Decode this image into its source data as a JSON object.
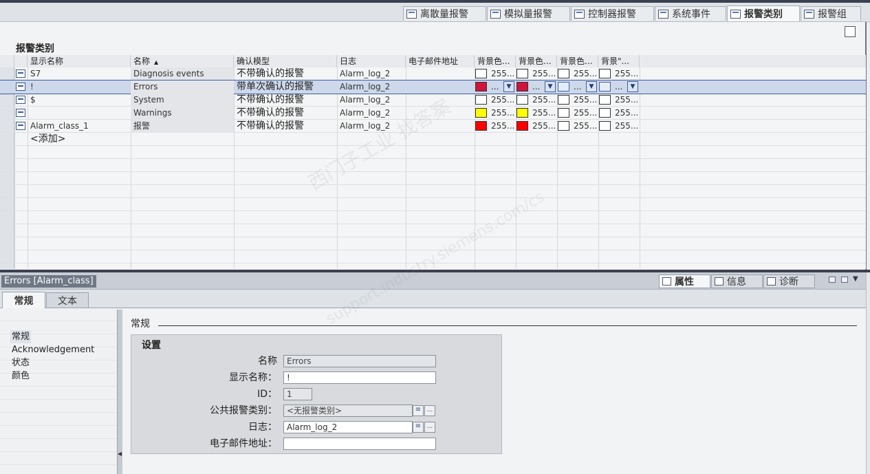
{
  "top_tabs": [
    {
      "label": "离散量报警",
      "icon": "discrete-alarm-icon",
      "active": false
    },
    {
      "label": "模拟量报警",
      "icon": "analog-alarm-icon",
      "active": false
    },
    {
      "label": "控制器报警",
      "icon": "controller-alarm-icon",
      "active": false
    },
    {
      "label": "系统事件",
      "icon": "system-event-icon",
      "active": false
    },
    {
      "label": "报警类别",
      "icon": "alarm-class-icon",
      "active": true
    },
    {
      "label": "报警组",
      "icon": "alarm-group-icon",
      "active": false
    }
  ],
  "editor": {
    "title": "报警类别",
    "columns": [
      "显示名称",
      "名称",
      "确认模型",
      "日志",
      "电子邮件地址",
      "背景色...",
      "背景色...",
      "背景色...",
      "背景\"..."
    ],
    "sort_column": "名称",
    "rows": [
      {
        "display": "S7",
        "name": "Diagnosis events",
        "ack": "不带确认的报警",
        "log": "Alarm_log_2",
        "email": "",
        "colors": [
          {
            "hex": "#ffffff",
            "val": "255..."
          },
          {
            "hex": "#ffffff",
            "val": "255..."
          },
          {
            "hex": "#ffffff",
            "val": "255..."
          },
          {
            "hex": "#ffffff",
            "val": "255..."
          }
        ],
        "selected": false
      },
      {
        "display": "!",
        "name": "Errors",
        "ack": "带单次确认的报警",
        "log": "Alarm_log_2",
        "email": "",
        "colors": [
          {
            "hex": "#d0143c",
            "val": "..."
          },
          {
            "hex": "#d0143c",
            "val": "..."
          },
          {
            "hex": "#e6ecf6",
            "val": "..."
          },
          {
            "hex": "#e6ecf6",
            "val": "..."
          }
        ],
        "selected": true
      },
      {
        "display": "$",
        "name": "System",
        "ack": "不带确认的报警",
        "log": "Alarm_log_2",
        "email": "",
        "colors": [
          {
            "hex": "#ffffff",
            "val": "255..."
          },
          {
            "hex": "#ffffff",
            "val": "255..."
          },
          {
            "hex": "#ffffff",
            "val": "255..."
          },
          {
            "hex": "#ffffff",
            "val": "255..."
          }
        ],
        "selected": false
      },
      {
        "display": "",
        "name": "Warnings",
        "ack": "不带确认的报警",
        "log": "Alarm_log_2",
        "email": "",
        "colors": [
          {
            "hex": "#ffff00",
            "val": "255..."
          },
          {
            "hex": "#ffff00",
            "val": "255..."
          },
          {
            "hex": "#ffffff",
            "val": "255..."
          },
          {
            "hex": "#ffffff",
            "val": "255..."
          }
        ],
        "selected": false
      },
      {
        "display": "Alarm_class_1",
        "name": "报警",
        "ack": "不带确认的报警",
        "log": "Alarm_log_2",
        "email": "",
        "colors": [
          {
            "hex": "#ff0000",
            "val": "255..."
          },
          {
            "hex": "#ff0000",
            "val": "255..."
          },
          {
            "hex": "#ffffff",
            "val": "255..."
          },
          {
            "hex": "#ffffff",
            "val": "255..."
          }
        ],
        "selected": false
      }
    ],
    "add_row": "<添加>"
  },
  "inspector": {
    "title": "Errors [Alarm_class]",
    "tabs": [
      {
        "label": "属性",
        "icon": "properties-icon",
        "active": true
      },
      {
        "label": "信息",
        "icon": "info-icon",
        "active": false
      },
      {
        "label": "诊断",
        "icon": "diagnostics-icon",
        "active": false
      }
    ],
    "subtabs": [
      "常规",
      "文本"
    ],
    "nav_items": [
      "常规",
      "Acknowledgement",
      "状态",
      "颜色"
    ],
    "section_title": "常规",
    "settings": {
      "title": "设置",
      "name_label": "名称",
      "name_value": "Errors",
      "display_label": "显示名称：",
      "display_value": "!",
      "id_label": "ID：",
      "id_value": "1",
      "common_label": "公共报警类别：",
      "common_value": "<无报警类别>",
      "log_label": "日志：",
      "log_value": "Alarm_log_2",
      "email_label": "电子邮件地址：",
      "email_value": ""
    }
  },
  "watermark": {
    "line1": "西门子工业   找答案",
    "line2": "support.industry.siemens.com/cs"
  }
}
